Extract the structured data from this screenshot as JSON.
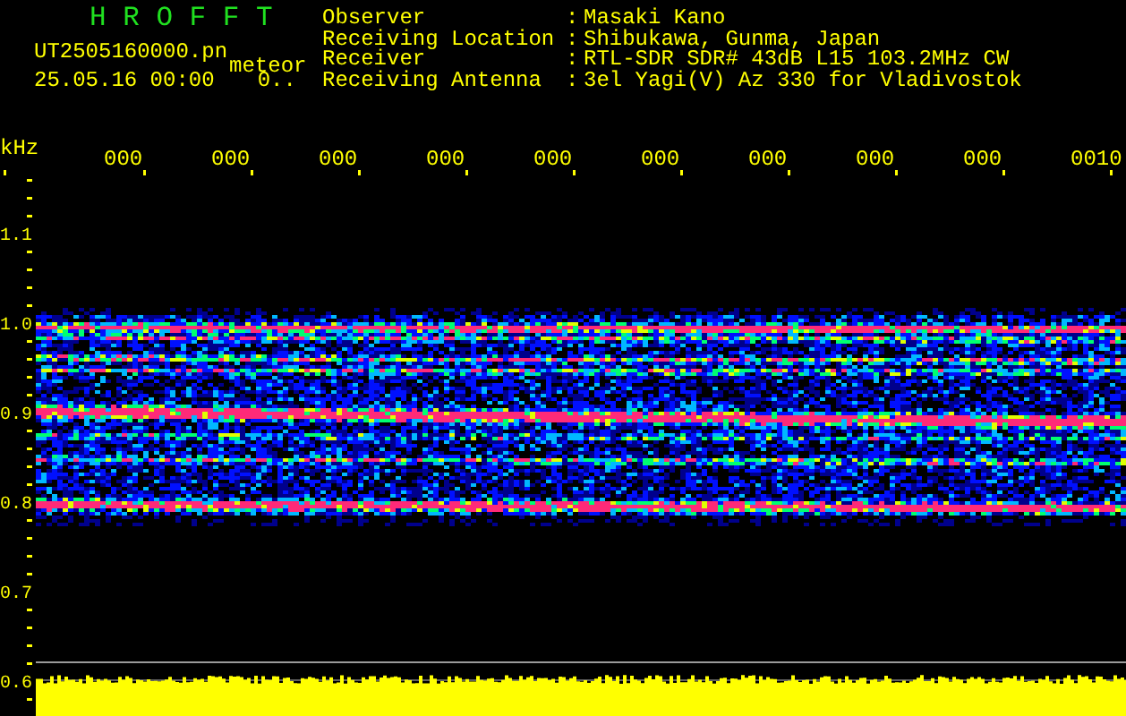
{
  "header": {
    "title": "H R O F F T",
    "filename": "UT2505160000.pn",
    "tag": "meteor",
    "datetime": "25.05.16 00:00",
    "count": "0..",
    "info": [
      {
        "label": "Observer",
        "colon": ":",
        "value": "Masaki Kano"
      },
      {
        "label": "Receiving Location",
        "colon": ":",
        "value": "Shibukawa, Gunma, Japan"
      },
      {
        "label": "Receiver",
        "colon": ":",
        "value": "RTL-SDR SDR# 43dB L15 103.2MHz CW"
      },
      {
        "label": "Receiving Antenna",
        "colon": ":",
        "value": "3el Yagi(V) Az 330 for Vladivostok"
      }
    ]
  },
  "plot": {
    "unit": "kHz",
    "time_labels": [
      "000",
      "000",
      "000",
      "000",
      "000",
      "000",
      "000",
      "000",
      "000",
      "0010"
    ],
    "freq_labels": [
      "1.1",
      "1.0",
      "0.9",
      "0.8",
      "0.7",
      "0.6"
    ]
  }
}
